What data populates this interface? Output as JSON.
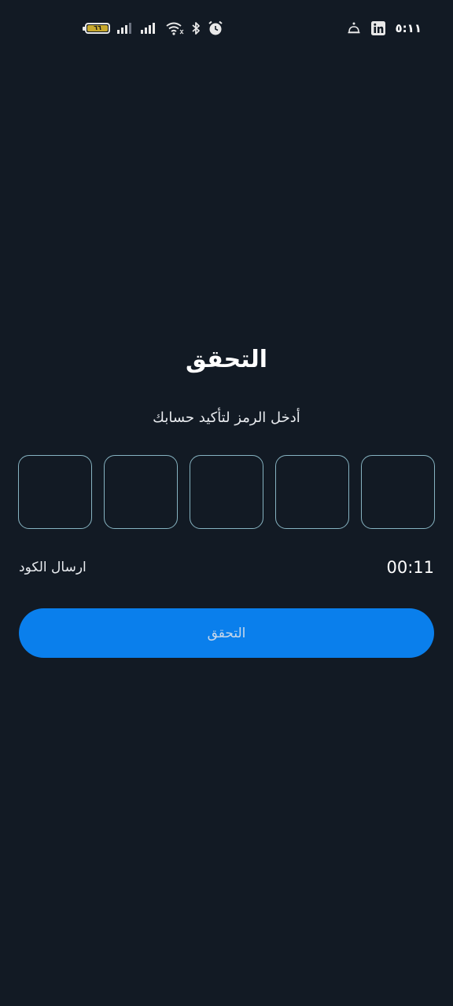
{
  "status_bar": {
    "battery_level": "٦٦",
    "time": "٥:١١",
    "icons": [
      "battery-icon",
      "signal-icon",
      "signal-icon",
      "wifi-icon",
      "bluetooth-icon",
      "alarm-icon",
      "notification-icon",
      "linkedin-icon"
    ]
  },
  "screen": {
    "title": "التحقق",
    "subtitle": "أدخل الرمز لتأكيد حسابك",
    "otp_boxes": [
      "",
      "",
      "",
      "",
      ""
    ],
    "timer": "00:11",
    "resend_label": "ارسال الكود",
    "verify_button_label": "التحقق"
  },
  "colors": {
    "background": "#121a24",
    "otp_border": "#86b3c1",
    "primary_button": "#0a7fec",
    "battery_fill": "#c8a92e"
  }
}
